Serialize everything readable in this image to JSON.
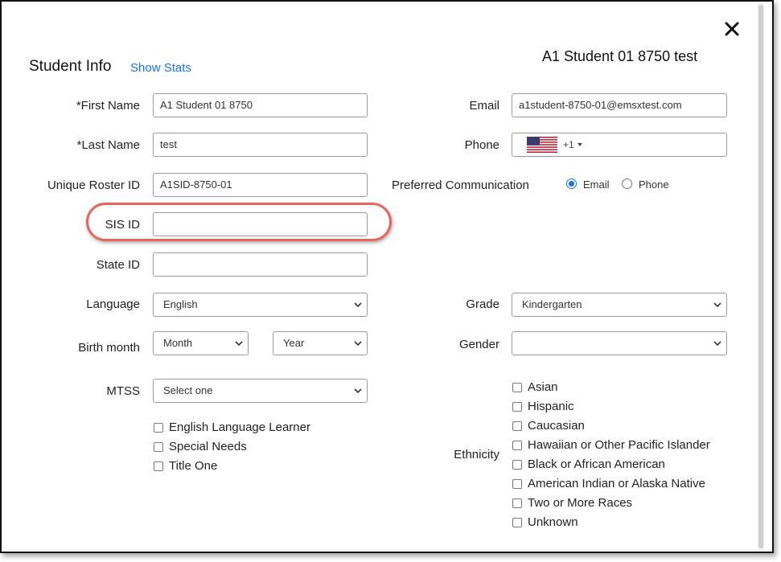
{
  "header": {
    "section_title": "Student Info",
    "show_stats": "Show Stats",
    "student_name": "A1 Student 01 8750 test"
  },
  "fields": {
    "first_name": {
      "label": "*First Name",
      "value": "A1 Student 01 8750"
    },
    "last_name": {
      "label": "*Last Name",
      "value": "test"
    },
    "roster_id": {
      "label": "Unique Roster ID",
      "value": "A1SID-8750-01"
    },
    "sis_id": {
      "label": "SIS ID",
      "value": ""
    },
    "state_id": {
      "label": "State ID",
      "value": ""
    },
    "language": {
      "label": "Language",
      "value": "English"
    },
    "birth_month": {
      "label": "Birth month",
      "month": "Month",
      "year": "Year"
    },
    "mtss": {
      "label": "MTSS",
      "value": "Select one"
    },
    "email": {
      "label": "Email",
      "value": "a1student-8750-01@emsxtest.com"
    },
    "phone": {
      "label": "Phone",
      "code": "+1"
    },
    "preferred_comm": {
      "label": "Preferred Communication",
      "options": [
        "Email",
        "Phone"
      ],
      "selected": "Email"
    },
    "grade": {
      "label": "Grade",
      "value": "Kindergarten"
    },
    "gender": {
      "label": "Gender",
      "value": ""
    }
  },
  "programs": [
    "English Language Learner",
    "Special Needs",
    "Title One"
  ],
  "ethnicity": {
    "label": "Ethnicity",
    "options": [
      "Asian",
      "Hispanic",
      "Caucasian",
      "Hawaiian or Other Pacific Islander",
      "Black or African American",
      "American Indian or Alaska Native",
      "Two or More Races",
      "Unknown"
    ]
  },
  "colors": {
    "accent": "#1a73e8",
    "highlight": "#e8655a"
  }
}
